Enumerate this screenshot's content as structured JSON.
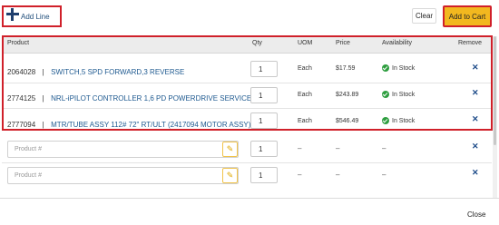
{
  "toolbar": {
    "add_line_label": "Add Line",
    "clear_label": "Clear",
    "add_to_cart_label": "Add to Cart"
  },
  "table": {
    "columns": {
      "product": "Product",
      "qty": "Qty",
      "uom": "UOM",
      "price": "Price",
      "availability": "Availability",
      "remove": "Remove"
    },
    "rows": [
      {
        "number": "2064028",
        "separator": "|",
        "description": "SWITCH,5 SPD FORWARD,3 REVERSE",
        "qty": "1",
        "uom": "Each",
        "price": "$17.59",
        "availability": "In Stock",
        "remove": "✕"
      },
      {
        "number": "2774125",
        "separator": "|",
        "description": "NRL-iPILOT CONTROLLER 1,6 PD POWERDRIVE SERVICE ...",
        "qty": "1",
        "uom": "Each",
        "price": "$243.89",
        "availability": "In Stock",
        "remove": "✕"
      },
      {
        "number": "2777094",
        "separator": "|",
        "description": "MTR/TUBE ASSY 112# 72\" RT/ULT (2417094 MOTOR ASSY)",
        "qty": "1",
        "uom": "Each",
        "price": "$546.49",
        "availability": "In Stock",
        "remove": "✕"
      }
    ],
    "empty_rows": [
      {
        "placeholder": "Product #",
        "qty": "1",
        "uom": "–",
        "price": "–",
        "availability": "–",
        "remove": "✕"
      },
      {
        "placeholder": "Product #",
        "qty": "1",
        "uom": "–",
        "price": "–",
        "availability": "–",
        "remove": "✕"
      }
    ]
  },
  "footer": {
    "close_label": "Close"
  },
  "colors": {
    "accent_yellow": "#f2b81f",
    "highlight_red": "#d0202a",
    "link_blue": "#1f5a90",
    "in_stock_green": "#2e9e3f"
  },
  "icons": {
    "add": "plus-icon",
    "in_stock": "check-circle-icon",
    "remove": "close-icon",
    "edit": "edit-icon"
  }
}
